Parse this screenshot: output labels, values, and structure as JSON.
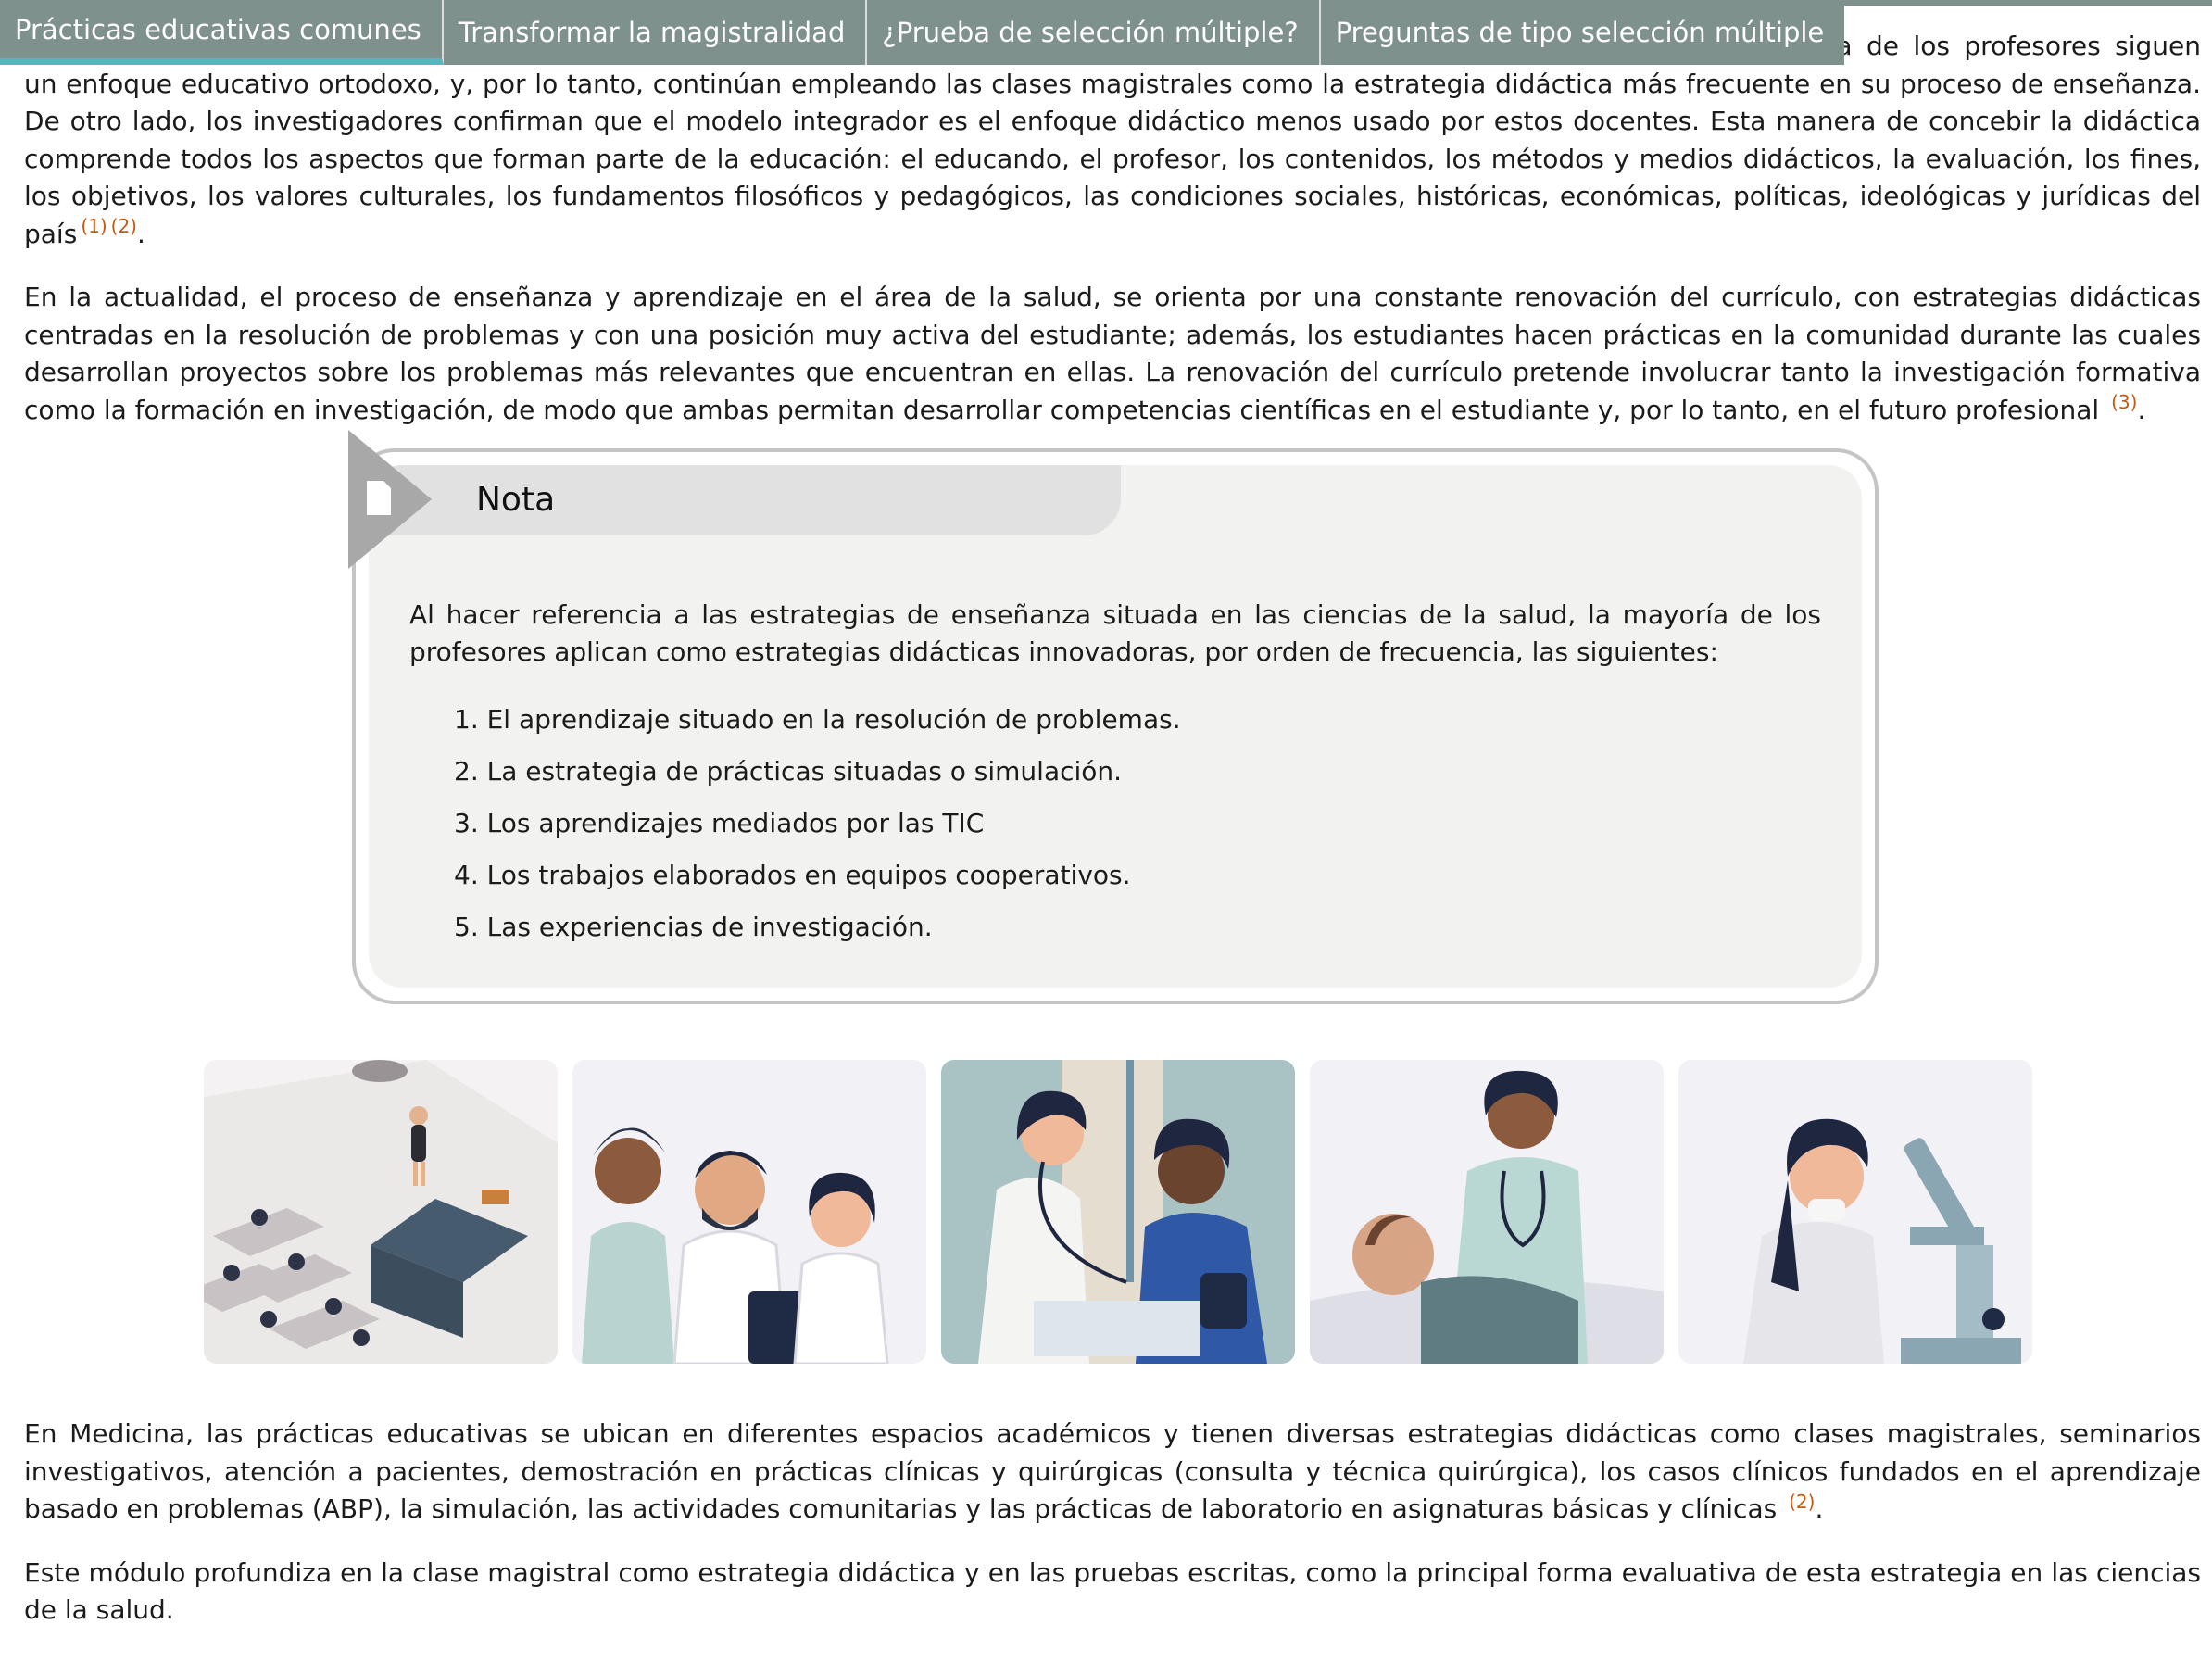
{
  "tabs": [
    {
      "label": "Prácticas educativas comunes",
      "active": true
    },
    {
      "label": "Transformar la magistralidad",
      "active": false
    },
    {
      "label": "¿Prueba de selección múltiple?",
      "active": false
    },
    {
      "label": "Preguntas de tipo selección múltiple",
      "active": false
    }
  ],
  "paragraphs": {
    "p1_text": "oría de los profesores siguen un enfoque educativo ortodoxo, y, por lo tanto, continúan empleando las clases magistrales como la estrategia didáctica más frecuente en su proceso de enseñanza. De otro lado, los investigadores confirman que el modelo integrador es el enfoque didáctico menos usado por estos docentes. Esta manera de concebir la didáctica comprende todos los aspectos que forman parte de la educación: el educando, el profesor, los contenidos, los métodos y medios didácticos, la evaluación, los fines, los objetivos, los valores culturales, los fundamentos filosóficos y pedagógicos, las condiciones sociales, históricas, económicas, políticas, ideológicas y jurídicas del país",
    "p1_cite1": "(1)",
    "p1_cite2": "(2)",
    "p2_text": "En la actualidad, el proceso de enseñanza y aprendizaje en el área de la salud, se orienta por una constante renovación del currículo, con estrategias didácticas centradas en la resolución de problemas y con una posición muy activa del estudiante; además, los estudiantes hacen prácticas en la comunidad durante las cuales desarrollan proyectos sobre los problemas más relevantes que encuentran en ellas. La renovación del currículo pretende involucrar tanto la investigación formativa como la formación en investigación, de modo que ambas permitan desarrollar competencias científicas en el estudiante y, por lo tanto, en el futuro profesional",
    "p2_cite": "(3)",
    "p3_text": "En Medicina, las prácticas educativas se ubican en diferentes espacios académicos y tienen diversas estrategias didácticas como clases magistrales, seminarios investigativos, atención a pacientes, demostración en prácticas clínicas y quirúrgicas (consulta y técnica quirúrgica), los casos clínicos fundados en el aprendizaje basado en problemas (ABP), la simulación, las actividades comunitarias y las prácticas de laboratorio en asignaturas básicas y clínicas",
    "p3_cite": "(2)",
    "p4_text": "Este módulo profundiza en la clase magistral como estrategia didáctica y en las pruebas escritas, como la principal forma evaluativa de esta estrategia en las ciencias de la salud."
  },
  "note": {
    "title": "Nota",
    "intro": "Al hacer referencia a las estrategias de enseñanza situada en las ciencias de la salud, la mayoría de los profesores aplican como estrategias didácticas innovadoras, por orden de frecuencia, las siguientes:",
    "items": [
      "1. El aprendizaje situado en la resolución de problemas.",
      "2. La estrategia de prácticas situadas o simulación.",
      "3. Los aprendizajes mediados por las TIC",
      "4. Los trabajos elaborados en equipos cooperativos.",
      "5. Las experiencias de investigación."
    ],
    "icon": "document-icon"
  },
  "gallery": {
    "icons": [
      "classroom-illustration",
      "doctors-team-illustration",
      "blood-pressure-illustration",
      "patient-care-illustration",
      "microscope-illustration"
    ]
  },
  "colors": {
    "tab_bg": "#7f918d",
    "tab_active_underline": "#52b8bc",
    "citation": "#c55a11"
  }
}
